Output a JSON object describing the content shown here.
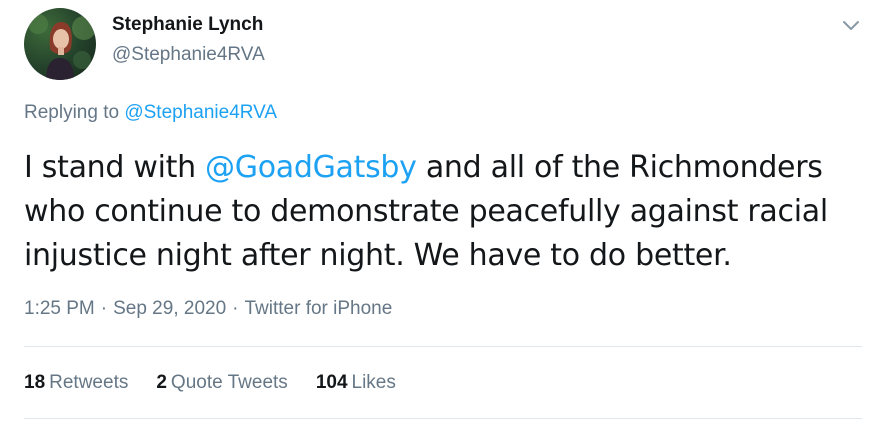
{
  "author": {
    "display_name": "Stephanie Lynch",
    "handle": "@Stephanie4RVA"
  },
  "reply": {
    "prefix": "Replying to",
    "target": "@Stephanie4RVA"
  },
  "tweet": {
    "text_before": "I stand with ",
    "mention": "@GoadGatsby",
    "text_after": " and all of the Richmonders who continue to demonstrate peacefully against racial injustice night after night. We have to do better."
  },
  "meta": {
    "time": "1:25 PM",
    "separator": "·",
    "date": "Sep 29, 2020",
    "source": "Twitter for iPhone"
  },
  "stats": {
    "retweets_count": "18",
    "retweets_label": "Retweets",
    "quotes_count": "2",
    "quotes_label": "Quote Tweets",
    "likes_count": "104",
    "likes_label": "Likes"
  },
  "icons": {
    "menu": "chevron-down-icon"
  },
  "colors": {
    "link": "#1da1f2",
    "secondary_text": "#657786",
    "primary_text": "#14171a",
    "divider": "#e1e8ed"
  }
}
